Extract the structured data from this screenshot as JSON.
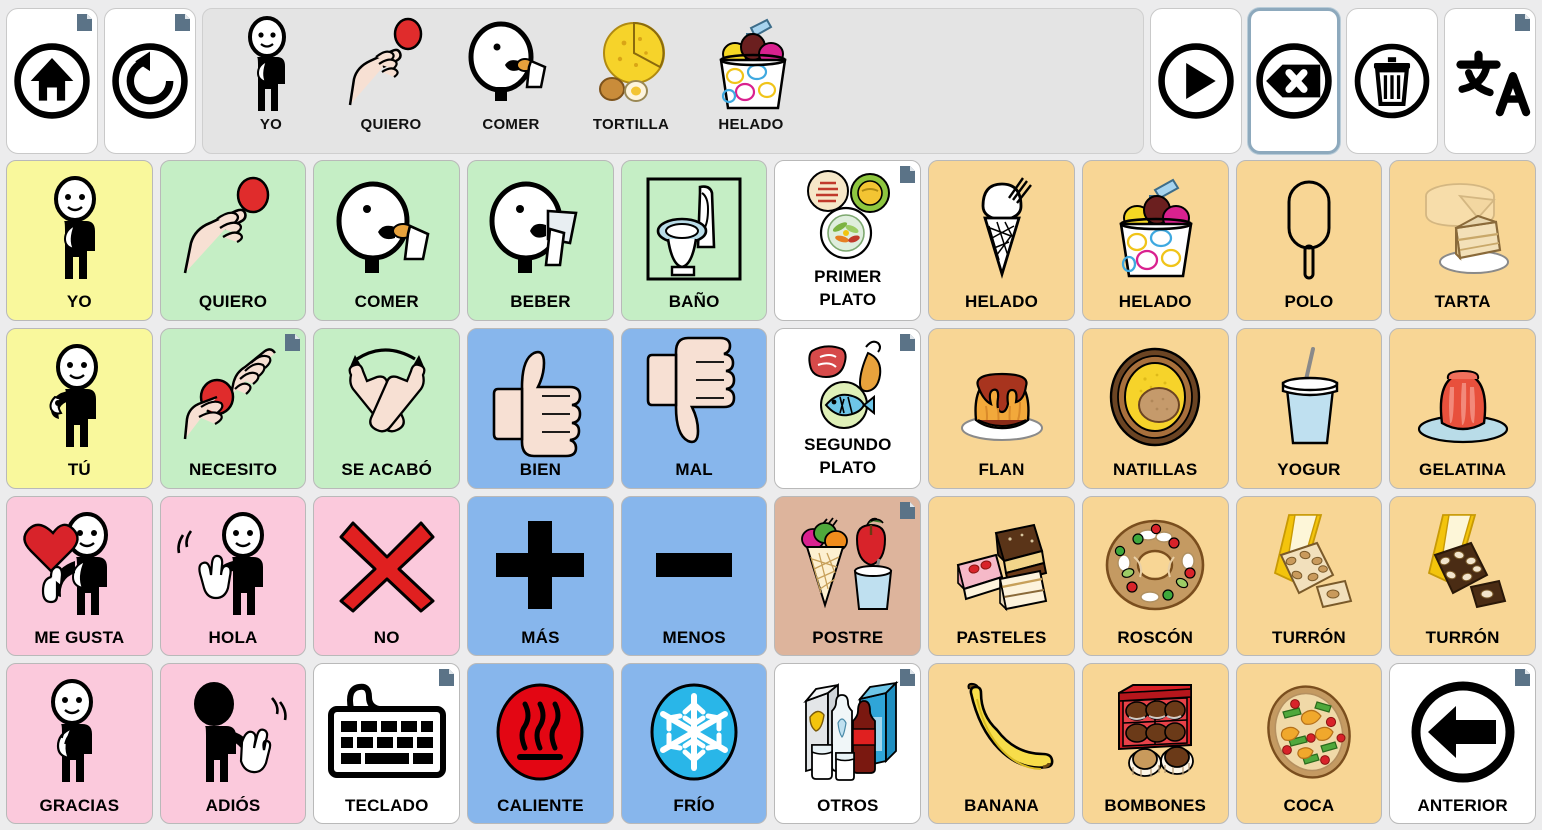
{
  "app": {
    "title": "Tablero de comunicacion pictografica"
  },
  "toolbar": {
    "left": [
      {
        "name": "home-button",
        "icon": "home-icon",
        "label": "Inicio",
        "has_corner": true
      },
      {
        "name": "undo-button",
        "icon": "undo-icon",
        "label": "Deshacer",
        "has_corner": true
      }
    ],
    "right": [
      {
        "name": "play-button",
        "icon": "play-icon",
        "label": "Reproducir",
        "selected": false,
        "has_corner": false
      },
      {
        "name": "backspace-button",
        "icon": "backspace-icon",
        "label": "Borrar ultimo",
        "selected": true,
        "has_corner": false
      },
      {
        "name": "trash-button",
        "icon": "trash-icon",
        "label": "Vaciar",
        "selected": false,
        "has_corner": false
      },
      {
        "name": "translate-button",
        "icon": "translate-icon",
        "label": "Traducir",
        "selected": false,
        "has_corner": true
      }
    ]
  },
  "sentence_bar": {
    "items": [
      {
        "label": "YO",
        "pic": "person-self"
      },
      {
        "label": "QUIERO",
        "pic": "hand-reach-ball"
      },
      {
        "label": "COMER",
        "pic": "head-eating"
      },
      {
        "label": "TORTILLA",
        "pic": "tortilla"
      },
      {
        "label": "HELADO",
        "pic": "icecream-tub"
      }
    ]
  },
  "colors": {
    "pronoun_yellow": "#f9f89c",
    "verb_green": "#c5eec5",
    "adjective_blue": "#87b6ec",
    "social_pink": "#fbc9dc",
    "noun_orange": "#f8d695",
    "category_white": "#ffffff",
    "dessert_tan": "#ddb49c",
    "page_background": "#ececed",
    "sentence_bar_background": "#e4e4e4",
    "selection_border": "#8da9bd"
  },
  "grid": {
    "columns": 10,
    "rows": 4,
    "cells": [
      {
        "label": "YO",
        "color": "c-yellow",
        "pic": "person-self",
        "corner": false
      },
      {
        "label": "QUIERO",
        "color": "c-green",
        "pic": "hand-reach-ball",
        "corner": false
      },
      {
        "label": "COMER",
        "color": "c-green",
        "pic": "head-eating",
        "corner": false
      },
      {
        "label": "BEBER",
        "color": "c-green",
        "pic": "head-drinking",
        "corner": false
      },
      {
        "label": "BAÑO",
        "color": "c-green",
        "pic": "toilet",
        "corner": false
      },
      {
        "label": "PRIMER\nPLATO",
        "color": "c-white",
        "pic": "first-course",
        "corner": true
      },
      {
        "label": "HELADO",
        "color": "c-orange",
        "pic": "icecream-cone",
        "corner": false
      },
      {
        "label": "HELADO",
        "color": "c-orange",
        "pic": "icecream-tub",
        "corner": false
      },
      {
        "label": "POLO",
        "color": "c-orange",
        "pic": "popsicle",
        "corner": false
      },
      {
        "label": "TARTA",
        "color": "c-orange",
        "pic": "cake-slice",
        "corner": false
      },
      {
        "label": "TÚ",
        "color": "c-yellow",
        "pic": "person-pointing",
        "corner": false
      },
      {
        "label": "NECESITO",
        "color": "c-green",
        "pic": "hands-giving-ball",
        "corner": true
      },
      {
        "label": "SE ACABÓ",
        "color": "c-green",
        "pic": "hands-crossed",
        "corner": false
      },
      {
        "label": "BIEN",
        "color": "c-blue",
        "pic": "thumb-up",
        "corner": false
      },
      {
        "label": "MAL",
        "color": "c-blue",
        "pic": "thumb-down",
        "corner": false
      },
      {
        "label": "SEGUNDO\nPLATO",
        "color": "c-white",
        "pic": "second-course",
        "corner": true
      },
      {
        "label": "FLAN",
        "color": "c-orange",
        "pic": "flan",
        "corner": false
      },
      {
        "label": "NATILLAS",
        "color": "c-orange",
        "pic": "custard",
        "corner": false
      },
      {
        "label": "YOGUR",
        "color": "c-orange",
        "pic": "yogurt",
        "corner": false
      },
      {
        "label": "GELATINA",
        "color": "c-orange",
        "pic": "jelly",
        "corner": false
      },
      {
        "label": "ME GUSTA",
        "color": "c-pink",
        "pic": "person-heart-thumb",
        "corner": false
      },
      {
        "label": "HOLA",
        "color": "c-pink",
        "pic": "person-waving",
        "corner": false
      },
      {
        "label": "NO",
        "color": "c-pink",
        "pic": "red-cross",
        "corner": false
      },
      {
        "label": "MÁS",
        "color": "c-blue",
        "pic": "plus-sign",
        "corner": false
      },
      {
        "label": "MENOS",
        "color": "c-blue",
        "pic": "minus-sign",
        "corner": false
      },
      {
        "label": "POSTRE",
        "color": "c-tan",
        "pic": "dessert-group",
        "corner": true
      },
      {
        "label": "PASTELES",
        "color": "c-orange",
        "pic": "pastries",
        "corner": false
      },
      {
        "label": "ROSCÓN",
        "color": "c-orange",
        "pic": "roscon",
        "corner": false
      },
      {
        "label": "TURRÓN",
        "color": "c-orange",
        "pic": "turron-white",
        "corner": false
      },
      {
        "label": "TURRÓN",
        "color": "c-orange",
        "pic": "turron-dark",
        "corner": false
      },
      {
        "label": "GRACIAS",
        "color": "c-pink",
        "pic": "person-thanks",
        "corner": false
      },
      {
        "label": "ADIÓS",
        "color": "c-pink",
        "pic": "person-goodbye",
        "corner": false
      },
      {
        "label": "TECLADO",
        "color": "c-white",
        "pic": "keyboard",
        "corner": true
      },
      {
        "label": "CALIENTE",
        "color": "c-blue",
        "pic": "hot",
        "corner": false
      },
      {
        "label": "FRÍO",
        "color": "c-blue",
        "pic": "cold",
        "corner": false
      },
      {
        "label": "OTROS",
        "color": "c-white",
        "pic": "drinks-group",
        "corner": true
      },
      {
        "label": "BANANA",
        "color": "c-orange",
        "pic": "banana",
        "corner": false
      },
      {
        "label": "BOMBONES",
        "color": "c-orange",
        "pic": "chocolates",
        "corner": false
      },
      {
        "label": "COCA",
        "color": "c-orange",
        "pic": "coca-flatbread",
        "corner": false
      },
      {
        "label": "ANTERIOR",
        "color": "c-white",
        "pic": "back-arrow",
        "corner": true
      }
    ]
  }
}
